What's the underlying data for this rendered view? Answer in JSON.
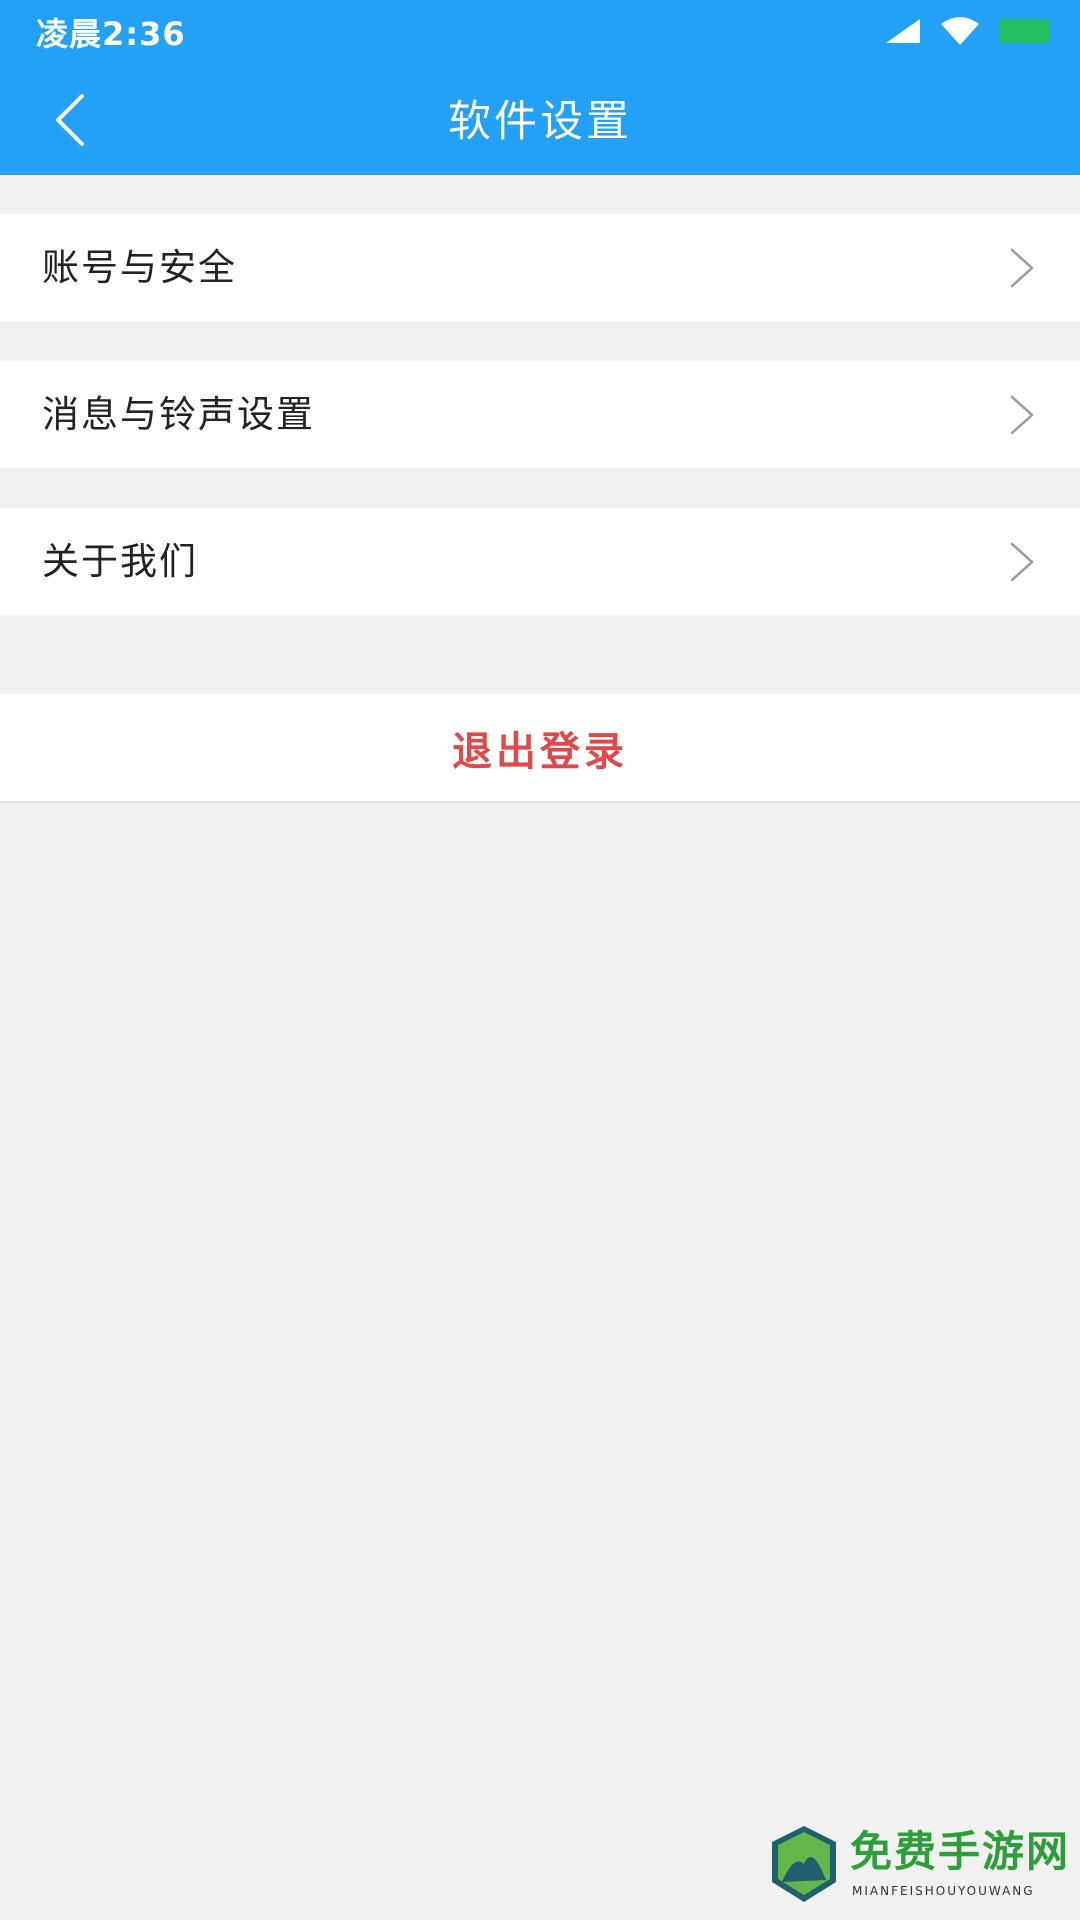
{
  "status_bar": {
    "time": "凌晨2:36",
    "battery_color": "#21c063"
  },
  "nav": {
    "title": "软件设置",
    "back_icon": "chevron-left-icon"
  },
  "menu": {
    "items": [
      {
        "label": "账号与安全",
        "icon": "chevron-right-icon"
      },
      {
        "label": "消息与铃声设置",
        "icon": "chevron-right-icon"
      },
      {
        "label": "关于我们",
        "icon": "chevron-right-icon"
      }
    ]
  },
  "logout": {
    "label": "退出登录",
    "color": "#e0484a"
  },
  "watermark": {
    "title": "免费手游网",
    "subtitle": "MIANFEISHOUYOUWANG"
  },
  "theme": {
    "header_color": "#23a1f6",
    "background": "#f1f1f1"
  }
}
